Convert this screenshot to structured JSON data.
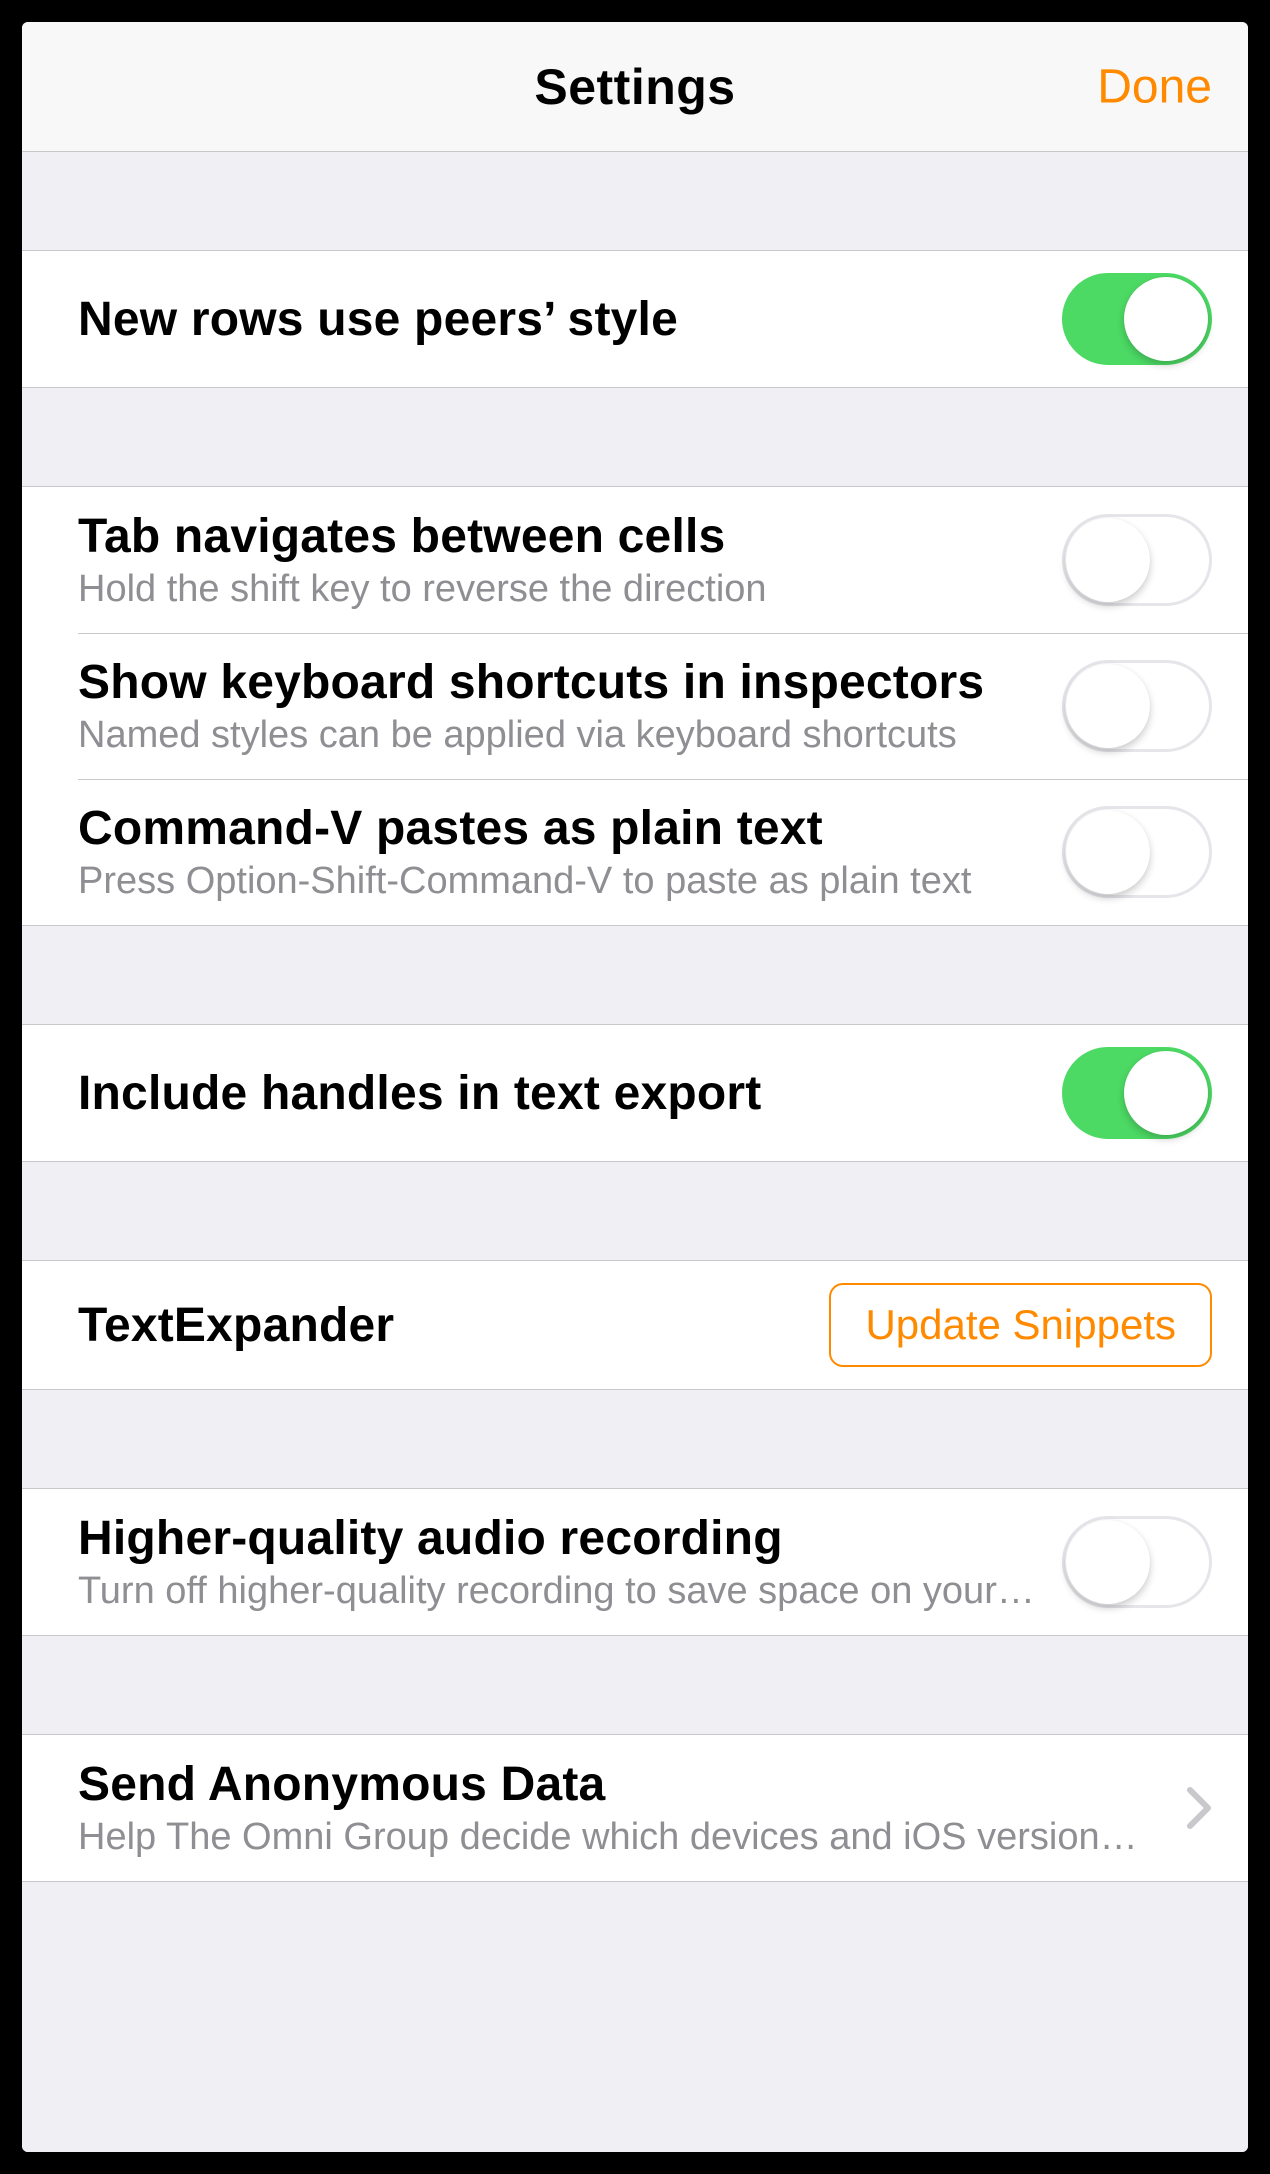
{
  "navbar": {
    "title": "Settings",
    "done": "Done"
  },
  "rows": {
    "peers_style": {
      "title": "New rows use peers’ style",
      "on": true
    },
    "tab_nav": {
      "title": "Tab navigates between cells",
      "sub": "Hold the shift key to reverse the direction",
      "on": false
    },
    "kb_shortcuts": {
      "title": "Show keyboard shortcuts in inspectors",
      "sub": "Named styles can be applied via keyboard shortcuts",
      "on": false
    },
    "cmd_v": {
      "title": "Command-V pastes as plain text",
      "sub": "Press Option-Shift-Command-V to paste as plain text",
      "on": false
    },
    "handles_export": {
      "title": "Include handles in text export",
      "on": true
    },
    "text_expander": {
      "title": "TextExpander",
      "button": "Update Snippets"
    },
    "audio": {
      "title": "Higher-quality audio recording",
      "sub": "Turn off higher-quality recording to save space on your…",
      "on": false
    },
    "anon": {
      "title": "Send Anonymous Data",
      "sub": "Help The Omni Group decide which devices and iOS versions…"
    }
  }
}
